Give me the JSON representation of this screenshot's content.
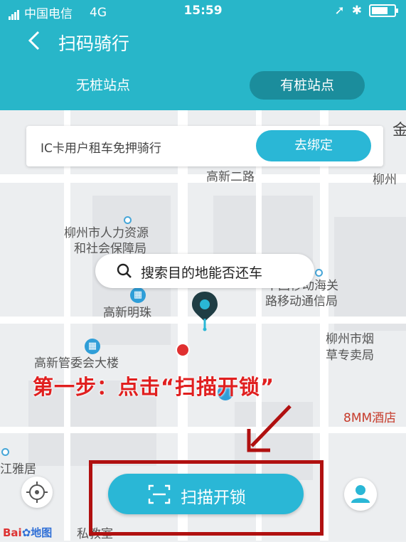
{
  "status_bar": {
    "carrier": "中国电信",
    "network": "4G",
    "time": "15:59"
  },
  "header": {
    "title": "扫码骑行"
  },
  "tabs": [
    {
      "label": "无桩站点"
    },
    {
      "label": "有桩站点"
    }
  ],
  "ic_card": {
    "text": "IC卡用户租车免押骑行",
    "button_label": "去绑定"
  },
  "search": {
    "placeholder": "搜索目的地能否还车"
  },
  "map_labels": {
    "road": "高新二路",
    "hr_line1": "柳州市人力资源",
    "hr_line2": "和社会保障局",
    "mobile_line1": "中国移动海关",
    "mobile_line2": "路移动通信局",
    "mingzhu": "高新明珠",
    "tobacco_line1": "柳州市烟",
    "tobacco_line2": "草专卖局",
    "committee": "高新管委会大楼",
    "hotel": "8MM酒店",
    "jiangya": "江雅居",
    "school": "私教室",
    "liuzhou_right": "柳州",
    "partial_top_right": "金"
  },
  "annotation": {
    "step_text": "第一步：点击“扫描开锁”"
  },
  "scan_button": {
    "label": "扫描开锁"
  },
  "watermark": {
    "text1": "Bai",
    "text2": "地图"
  },
  "colors": {
    "header": "#28b6c9",
    "button": "#2ab7d6",
    "annotation": "#e01f1f"
  }
}
